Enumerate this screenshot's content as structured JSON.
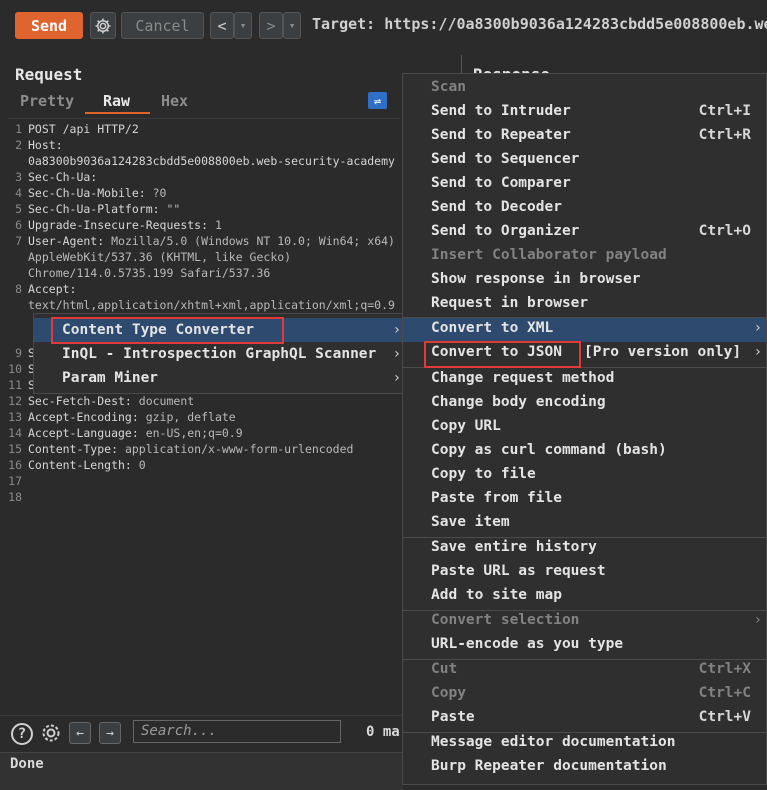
{
  "toolbar": {
    "send_label": "Send",
    "cancel_label": "Cancel",
    "back_label": "<",
    "forward_label": ">",
    "dropdown_label": "▾",
    "target_text": "Target: https://0a8300b9036a124283cbdd5e008800eb.we"
  },
  "request": {
    "title": "Request",
    "tabs": [
      "Pretty",
      "Raw",
      "Hex"
    ],
    "active_tab": "Raw",
    "lines": [
      {
        "n": "1",
        "k": "POST /api HTTP/2",
        "v": ""
      },
      {
        "n": "2",
        "k": "Host:",
        "v": ""
      },
      {
        "n": "",
        "k": "0a8300b9036a124283cbdd5e008800eb.web-security-academy",
        "v": ""
      },
      {
        "n": "3",
        "k": "Sec-Ch-Ua:",
        "v": ""
      },
      {
        "n": "4",
        "k": "Sec-Ch-Ua-Mobile:",
        "v": " ?0"
      },
      {
        "n": "5",
        "k": "Sec-Ch-Ua-Platform:",
        "v": " \"\""
      },
      {
        "n": "6",
        "k": "Upgrade-Insecure-Requests:",
        "v": " 1"
      },
      {
        "n": "7",
        "k": "User-Agent:",
        "v": " Mozilla/5.0 (Windows NT 10.0; Win64; x64)"
      },
      {
        "n": "",
        "k": "",
        "v": "AppleWebKit/537.36 (KHTML, like Gecko)"
      },
      {
        "n": "",
        "k": "",
        "v": "Chrome/114.0.5735.199 Safari/537.36"
      },
      {
        "n": "8",
        "k": "Accept:",
        "v": ""
      },
      {
        "n": "",
        "k": "",
        "v": "text/html,application/xhtml+xml,application/xml;q=0.9"
      },
      {
        "n": "",
        "k": "",
        "v": ""
      },
      {
        "n": "",
        "k": "",
        "v": ""
      },
      {
        "n": "9",
        "k": "S",
        "v": ""
      },
      {
        "n": "10",
        "k": "S",
        "v": ""
      },
      {
        "n": "11",
        "k": "S",
        "v": ""
      },
      {
        "n": "12",
        "k": "Sec-Fetch-Dest:",
        "v": " document"
      },
      {
        "n": "13",
        "k": "Accept-Encoding:",
        "v": " gzip, deflate"
      },
      {
        "n": "14",
        "k": "Accept-Language:",
        "v": " en-US,en;q=0.9"
      },
      {
        "n": "15",
        "k": "Content-Type:",
        "v": " application/x-www-form-urlencoded"
      },
      {
        "n": "16",
        "k": "Content-Length:",
        "v": " 0"
      },
      {
        "n": "17",
        "k": "",
        "v": ""
      },
      {
        "n": "18",
        "k": "",
        "v": ""
      }
    ]
  },
  "response": {
    "title": "Response"
  },
  "bottom": {
    "help_label": "?",
    "search_placeholder": "Search...",
    "matches_text": "0 ma",
    "status_text": "Done"
  },
  "context_menu": {
    "items": [
      {
        "label": "Scan",
        "shortcut": "",
        "disabled": true
      },
      {
        "label": "Send to Intruder",
        "shortcut": "Ctrl+I",
        "disabled": false
      },
      {
        "label": "Send to Repeater",
        "shortcut": "Ctrl+R",
        "disabled": false
      },
      {
        "label": "Send to Sequencer",
        "shortcut": "",
        "disabled": false
      },
      {
        "label": "Send to Comparer",
        "shortcut": "",
        "disabled": false
      },
      {
        "label": "Send to Decoder",
        "shortcut": "",
        "disabled": false
      },
      {
        "label": "Send to Organizer",
        "shortcut": "Ctrl+O",
        "disabled": false
      },
      {
        "label": "Insert Collaborator payload",
        "shortcut": "",
        "disabled": true
      },
      {
        "label": "Show response in browser",
        "shortcut": "",
        "disabled": false
      },
      {
        "label": "Request in browser",
        "shortcut": "",
        "disabled": false
      },
      {
        "label": "Convert to XML",
        "shortcut": "",
        "disabled": false
      },
      {
        "label": "Convert to JSON",
        "shortcut": "",
        "disabled": false
      },
      {
        "label": "Change request method",
        "shortcut": "",
        "disabled": false
      },
      {
        "label": "Change body encoding",
        "shortcut": "",
        "disabled": false
      },
      {
        "label": "Copy URL",
        "shortcut": "",
        "disabled": false
      },
      {
        "label": "Copy as curl command (bash)",
        "shortcut": "",
        "disabled": false
      },
      {
        "label": "Copy to file",
        "shortcut": "",
        "disabled": false
      },
      {
        "label": "Paste from file",
        "shortcut": "",
        "disabled": false
      },
      {
        "label": "Save item",
        "shortcut": "",
        "disabled": false
      },
      {
        "label": "Save entire history",
        "shortcut": "",
        "disabled": false
      },
      {
        "label": "Paste URL as request",
        "shortcut": "",
        "disabled": false
      },
      {
        "label": "Add to site map",
        "shortcut": "",
        "disabled": false
      },
      {
        "label": "Convert selection",
        "shortcut": "",
        "disabled": true
      },
      {
        "label": "URL-encode as you type",
        "shortcut": "",
        "disabled": false
      },
      {
        "label": "Cut",
        "shortcut": "Ctrl+X",
        "disabled": true
      },
      {
        "label": "Copy",
        "shortcut": "Ctrl+C",
        "disabled": true
      },
      {
        "label": "Paste",
        "shortcut": "Ctrl+V",
        "disabled": false
      },
      {
        "label": "Message editor documentation",
        "shortcut": "",
        "disabled": false
      },
      {
        "label": "Burp Repeater documentation",
        "shortcut": "",
        "disabled": false
      }
    ],
    "pro_note": "[Pro version only]"
  },
  "extensions_submenu": {
    "items": [
      "Content Type Converter",
      "InQL - Introspection GraphQL Scanner",
      "Param Miner"
    ]
  },
  "colors": {
    "accent": "#e0642e",
    "highlight": "#2e4a6e",
    "annotation": "#e03a3a"
  }
}
